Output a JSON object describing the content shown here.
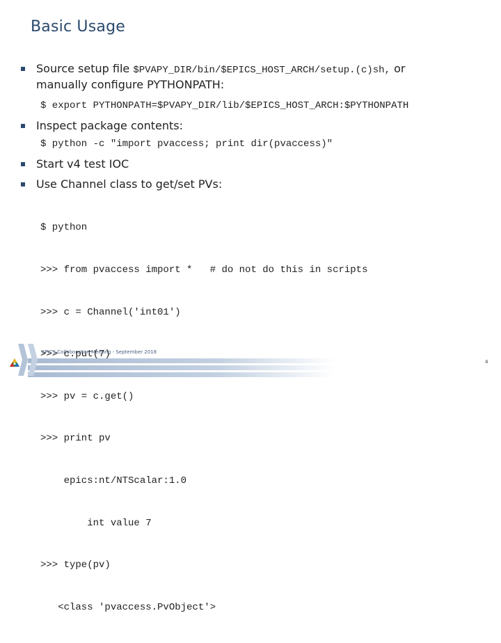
{
  "slide": {
    "title": "Basic Usage",
    "bullets": [
      {
        "text": "Source setup file ",
        "code_inline": "$PVAPY_DIR/bin/$EPICS_HOST_ARCH/setup.(c)sh,",
        "text_after": " or",
        "line2": "manually configure PYTHONPATH:",
        "code": [
          "$ export PYTHONPATH=$PVAPY_DIR/lib/$EPICS_HOST_ARCH:$PYTHONPATH"
        ]
      },
      {
        "text": "Inspect package contents:",
        "code": [
          "$ python -c \"import pvaccess; print dir(pvaccess)\""
        ]
      },
      {
        "text": "Start v4 test IOC"
      },
      {
        "text": "Use Channel class to get/set PVs:",
        "code": [
          "$ python",
          ">>> from pvaccess import *   # do not do this in scripts",
          ">>> c = Channel('int01')",
          ">>> c.put(7)",
          ">>> pv = c.get()",
          ">>> print pv",
          "    epics:nt/NTScalar:1.0",
          "        int value 7",
          ">>> type(pv)",
          "   <class 'pvaccess.PvObject'>"
        ]
      }
    ]
  },
  "footer": {
    "text": "EPICS Collaboration Meeting - September 2018",
    "page_number": "4",
    "logo_icon": "argonne-logo-icon"
  },
  "colors": {
    "title": "#2c4a6e",
    "bullet": "#2c4a6e",
    "footer_band": "#a9bbd3"
  }
}
